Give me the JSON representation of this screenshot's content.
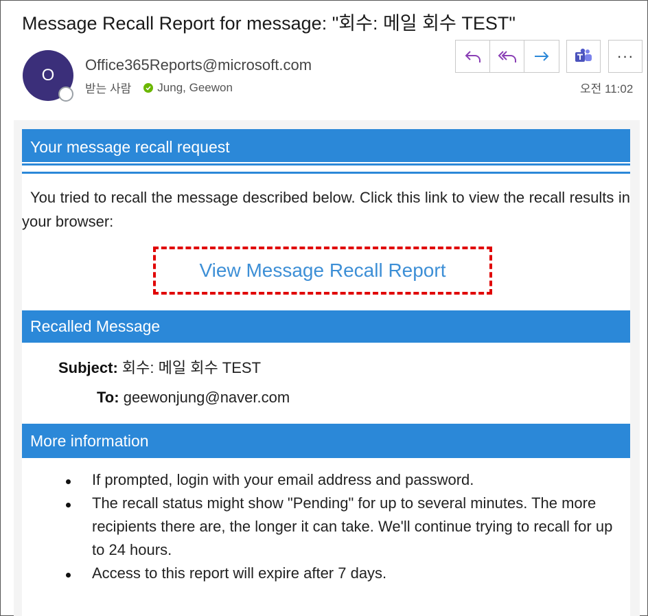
{
  "email": {
    "subject": "Message Recall Report for message: \"회수: 메일 회수 TEST\"",
    "avatar_initial": "O",
    "sender": "Office365Reports@microsoft.com",
    "to_label": "받는 사람",
    "recipient": "Jung, Geewon",
    "time": "오전 11:02"
  },
  "toolbar": {
    "reply_icon": "reply-icon",
    "reply_all_icon": "reply-all-icon",
    "forward_icon": "forward-icon",
    "teams_icon": "teams-icon",
    "more_label": "···"
  },
  "report": {
    "section1_title": "Your message recall request",
    "intro": "You tried to recall the message described below. Click this link to view the recall results in your browser:",
    "link_text": "View Message Recall Report",
    "section2_title": "Recalled Message",
    "subject_label": "Subject:",
    "subject_value": "회수: 메일 회수 TEST",
    "to_label": "To:",
    "to_value": "geewonjung@naver.com",
    "section3_title": "More information",
    "bullets": [
      "If prompted, login with your email address and password.",
      "The recall status might show \"Pending\" for up to several minutes. The more recipients there are, the longer it can take. We'll continue trying to recall for up to 24 hours.",
      "Access to this report will expire after 7 days."
    ]
  },
  "colors": {
    "accent": "#2b88d8",
    "link": "#3d8fd6",
    "highlight": "#e00000",
    "avatar": "#3b2f7a",
    "action_icon": "#8a3fb5",
    "presence_ok": "#6bb700"
  }
}
